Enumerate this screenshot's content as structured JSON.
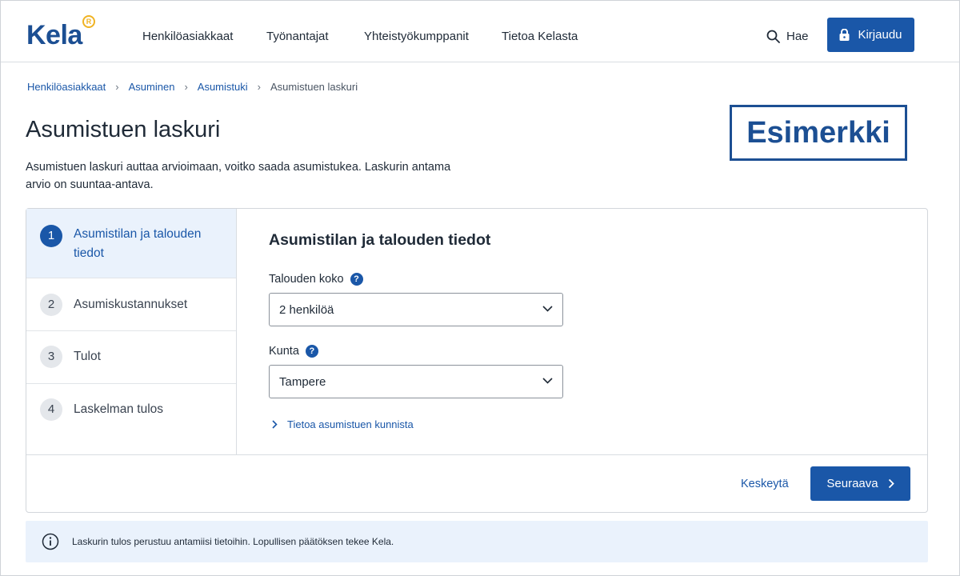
{
  "header": {
    "logo_text": "Kela",
    "logo_badge": "R",
    "nav": [
      {
        "label": "Henkilöasiakkaat"
      },
      {
        "label": "Työnantajat"
      },
      {
        "label": "Yhteistyökumppanit"
      },
      {
        "label": "Tietoa Kelasta"
      }
    ],
    "search_label": "Hae",
    "login_label": "Kirjaudu"
  },
  "breadcrumb": {
    "items": [
      "Henkilöasiakkaat",
      "Asuminen",
      "Asumistuki"
    ],
    "current": "Asumistuen laskuri"
  },
  "page": {
    "title": "Asumistuen laskuri",
    "intro": "Asumistuen laskuri auttaa arvioimaan, voitko saada asumistukea. Laskurin antama arvio on suuntaa-antava.",
    "stamp": "Esimerkki"
  },
  "steps": [
    {
      "number": "1",
      "label": "Asumistilan ja talouden tiedot",
      "active": true
    },
    {
      "number": "2",
      "label": "Asumiskustannukset",
      "active": false
    },
    {
      "number": "3",
      "label": "Tulot",
      "active": false
    },
    {
      "number": "4",
      "label": "Laskelman tulos",
      "active": false
    }
  ],
  "form": {
    "title": "Asumistilan ja talouden tiedot",
    "household_label": "Talouden koko",
    "household_value": "2 henkilöä",
    "municipality_label": "Kunta",
    "municipality_value": "Tampere",
    "help_glyph": "?",
    "info_link": "Tietoa asumistuen kunnista"
  },
  "footer": {
    "cancel_label": "Keskeytä",
    "next_label": "Seuraava"
  },
  "notice": {
    "text": "Laskurin tulos perustuu antamiisi tietoihin. Lopullisen päätöksen tekee Kela."
  },
  "colors": {
    "brand": "#1c4f93",
    "primary": "#1a57a8",
    "active_step_bg": "#eaf2fc",
    "logo_badge": "#f0b323"
  }
}
